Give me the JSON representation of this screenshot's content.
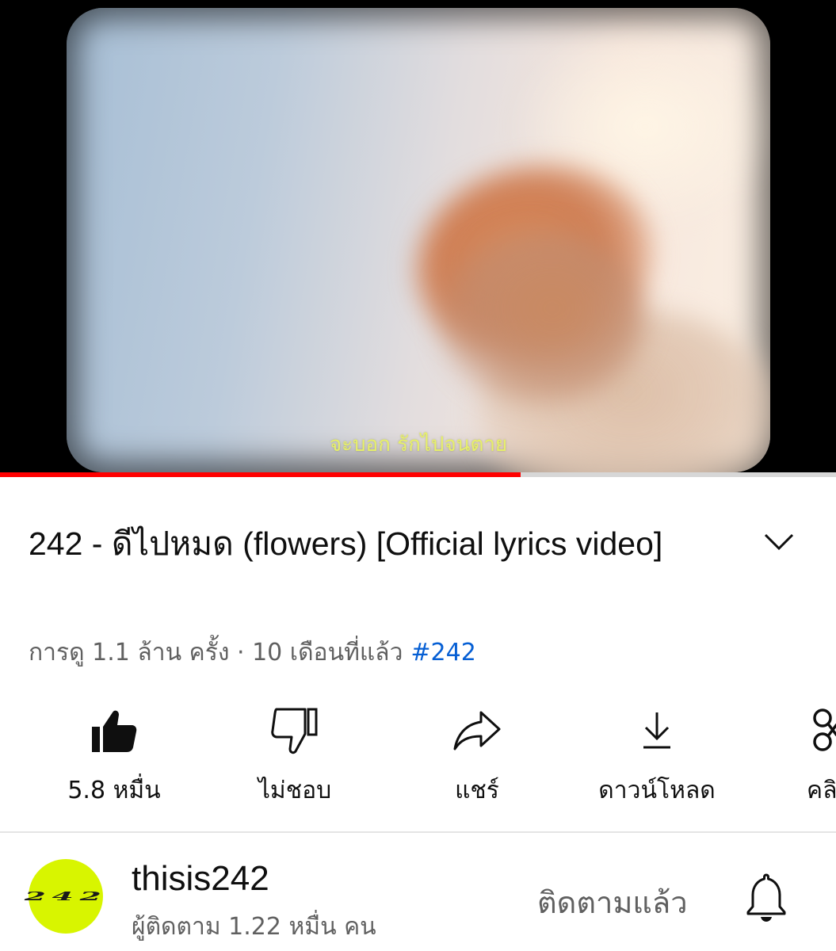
{
  "video": {
    "subtitle": "จะบอก รักไปจนตาย",
    "progress": 0.623
  },
  "title": "242 - ดีไปหมด (flowers)  [Official lyrics video]",
  "meta": {
    "views": "การดู 1.1 ล้าน ครั้ง · 10 เดือนที่แล้ว",
    "hashtag": "#242"
  },
  "actions": [
    {
      "icon": "thumbs-up-icon",
      "label": "5.8 หมื่น"
    },
    {
      "icon": "thumbs-down-icon",
      "label": "ไม่ชอบ"
    },
    {
      "icon": "share-icon",
      "label": "แชร์"
    },
    {
      "icon": "download-icon",
      "label": "ดาวน์โหลด"
    },
    {
      "icon": "clip-icon",
      "label": "คลิ"
    }
  ],
  "channel": {
    "avatar_text": "242",
    "name": "thisis242",
    "subscribers": "ผู้ติดตาม 1.22 หมื่น คน",
    "subscribe_state": "ติดตามแล้ว"
  },
  "colors": {
    "progress": "#ff0000",
    "hashtag": "#065fd4",
    "avatar_bg": "#d8f500",
    "subtitle": "#e7f06a"
  }
}
